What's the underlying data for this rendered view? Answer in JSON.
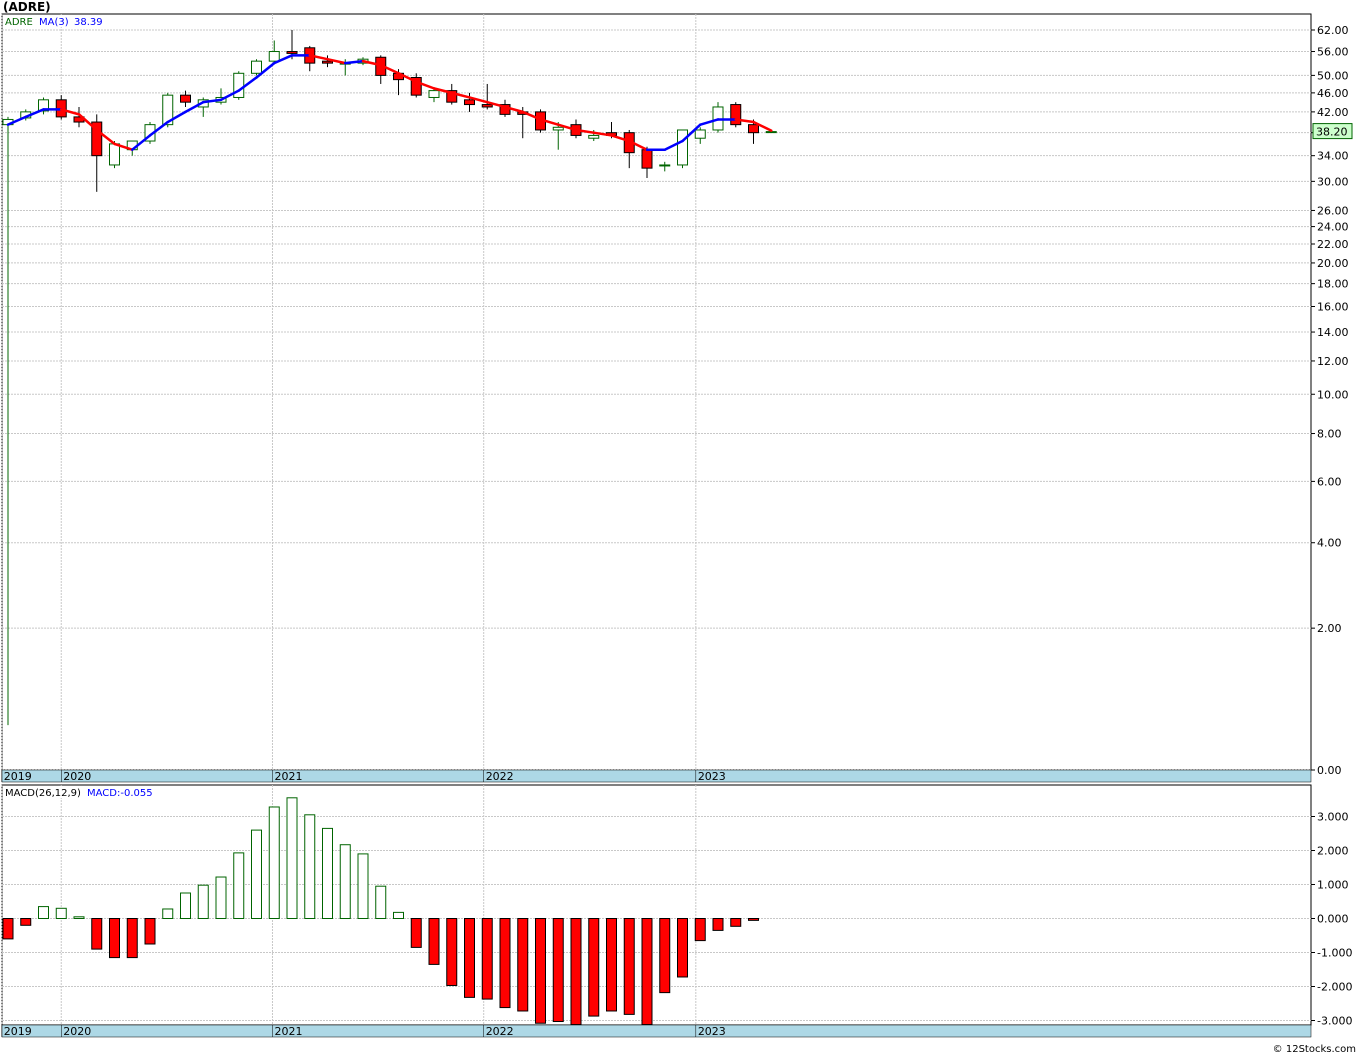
{
  "title": "(ADRE)",
  "copyright": "© 12Stocks.com",
  "price_legend": {
    "symbol": "ADRE",
    "ma_label": "MA(3)",
    "ma_value": "38.39"
  },
  "macd_legend": {
    "label": "MACD(26,12,9)",
    "value_label": "MACD:-0.055"
  },
  "last_price": "38.20",
  "colors": {
    "up_candle": "#006400",
    "down_candle": "#ff0000",
    "ma_up": "#0000ff",
    "ma_down": "#ff0000",
    "axis_band": "#add8e6",
    "grid": "#c8c8c8"
  },
  "chart_data": [
    {
      "type": "candlestick",
      "scale": "log",
      "ylim": [
        0,
        62
      ],
      "y_ticks": [
        "62.00",
        "56.00",
        "50.00",
        "46.00",
        "42.00",
        "38.00",
        "34.00",
        "30.00",
        "26.00",
        "24.00",
        "22.00",
        "20.00",
        "18.00",
        "16.00",
        "14.00",
        "12.00",
        "10.00",
        "8.00",
        "6.00",
        "4.00",
        "2.00",
        "0.00"
      ],
      "x_ticks": [
        "2019",
        "2020",
        "2021",
        "2022",
        "2023"
      ],
      "x": [
        "2019-11",
        "2019-12",
        "2020-01",
        "2020-02",
        "2020-03",
        "2020-04",
        "2020-05",
        "2020-06",
        "2020-07",
        "2020-08",
        "2020-09",
        "2020-10",
        "2020-11",
        "2020-12",
        "2021-01",
        "2021-02",
        "2021-03",
        "2021-04",
        "2021-05",
        "2021-06",
        "2021-07",
        "2021-08",
        "2021-09",
        "2021-10",
        "2021-11",
        "2021-12",
        "2022-01",
        "2022-02",
        "2022-03",
        "2022-04",
        "2022-05",
        "2022-06",
        "2022-07",
        "2022-08",
        "2022-09",
        "2022-10",
        "2022-11",
        "2022-12",
        "2023-01",
        "2023-02",
        "2023-03",
        "2023-04",
        "2023-05",
        "2023-06"
      ],
      "series": [
        {
          "ohlc": [
            [
              39.5,
              41.0,
              0.5,
              40.5
            ],
            [
              40.8,
              42.5,
              40.3,
              42.0
            ],
            [
              42.2,
              45.0,
              41.5,
              44.5
            ],
            [
              44.5,
              45.5,
              40.5,
              41.0
            ],
            [
              41.0,
              43.0,
              39.0,
              40.0
            ],
            [
              40.0,
              41.5,
              28.5,
              34.0
            ],
            [
              32.5,
              36.5,
              32.0,
              36.0
            ],
            [
              35.0,
              36.5,
              34.0,
              36.5
            ],
            [
              36.5,
              40.0,
              36.0,
              39.5
            ],
            [
              39.5,
              46.0,
              39.0,
              45.5
            ],
            [
              45.5,
              46.5,
              43.0,
              44.0
            ],
            [
              43.0,
              45.0,
              41.0,
              44.5
            ],
            [
              44.0,
              47.0,
              43.5,
              45.0
            ],
            [
              45.0,
              51.0,
              44.5,
              50.5
            ],
            [
              50.5,
              54.0,
              50.0,
              53.5
            ],
            [
              53.5,
              59.0,
              53.0,
              56.0
            ],
            [
              56.0,
              62.0,
              54.0,
              55.5
            ],
            [
              57.0,
              57.5,
              51.0,
              53.0
            ],
            [
              53.5,
              55.0,
              52.0,
              53.0
            ],
            [
              53.0,
              54.0,
              50.0,
              53.0
            ],
            [
              53.0,
              54.5,
              52.5,
              54.0
            ],
            [
              54.5,
              55.0,
              48.0,
              50.0
            ],
            [
              50.5,
              51.5,
              45.5,
              49.0
            ],
            [
              49.5,
              50.5,
              45.0,
              45.5
            ],
            [
              45.0,
              47.0,
              44.0,
              46.5
            ],
            [
              46.5,
              48.0,
              43.5,
              44.0
            ],
            [
              44.5,
              46.0,
              42.0,
              43.5
            ],
            [
              43.5,
              48.0,
              42.5,
              43.0
            ],
            [
              43.5,
              44.5,
              41.0,
              41.5
            ],
            [
              42.0,
              43.0,
              37.0,
              41.5
            ],
            [
              42.0,
              42.5,
              38.0,
              38.5
            ],
            [
              38.5,
              40.0,
              35.0,
              39.0
            ],
            [
              39.5,
              40.5,
              37.0,
              37.5
            ],
            [
              37.0,
              38.5,
              36.5,
              37.5
            ],
            [
              38.0,
              40.0,
              37.0,
              37.5
            ],
            [
              38.0,
              38.5,
              32.0,
              34.5
            ],
            [
              35.0,
              35.5,
              30.5,
              32.0
            ],
            [
              32.5,
              33.0,
              31.5,
              32.5
            ],
            [
              32.5,
              38.5,
              32.0,
              38.5
            ],
            [
              37.0,
              39.0,
              36.0,
              38.5
            ],
            [
              38.5,
              44.0,
              38.0,
              43.0
            ],
            [
              43.5,
              44.0,
              39.0,
              39.5
            ],
            [
              39.5,
              40.5,
              36.0,
              38.0
            ],
            [
              38.2,
              38.4,
              38.0,
              38.2
            ]
          ]
        },
        {
          "name": "MA(3)",
          "values": [
            39.5,
            41.0,
            42.5,
            42.5,
            41.5,
            38.5,
            36.0,
            35.0,
            37.5,
            40.0,
            42.0,
            44.0,
            44.5,
            46.5,
            49.5,
            53.0,
            55.0,
            55.0,
            54.0,
            53.0,
            53.5,
            52.5,
            50.5,
            48.5,
            47.0,
            46.0,
            45.0,
            44.0,
            43.0,
            42.0,
            40.5,
            39.5,
            38.5,
            38.0,
            37.5,
            36.5,
            35.0,
            35.0,
            36.5,
            39.5,
            40.5,
            40.5,
            40.0,
            38.39
          ]
        }
      ]
    },
    {
      "type": "bar",
      "x_ticks": [
        "2019",
        "2020",
        "2021",
        "2022",
        "2023"
      ],
      "y_ticks": [
        "3.000",
        "2.000",
        "1.000",
        "0.000",
        "-1.000",
        "-2.000",
        "-3.000"
      ],
      "ylim": [
        -3.1,
        3.6
      ],
      "series": [
        {
          "name": "MACD",
          "values": [
            -0.6,
            -0.2,
            0.35,
            0.3,
            0.05,
            -0.9,
            -1.15,
            -1.15,
            -0.75,
            0.28,
            0.75,
            0.98,
            1.22,
            1.93,
            2.6,
            3.28,
            3.55,
            3.05,
            2.65,
            2.17,
            1.9,
            0.95,
            0.18,
            -0.85,
            -1.35,
            -1.97,
            -2.32,
            -2.37,
            -2.62,
            -2.72,
            -3.08,
            -3.03,
            -3.12,
            -2.87,
            -2.72,
            -2.82,
            -3.12,
            -2.18,
            -1.72,
            -0.65,
            -0.35,
            -0.23,
            -0.055
          ]
        }
      ]
    }
  ]
}
